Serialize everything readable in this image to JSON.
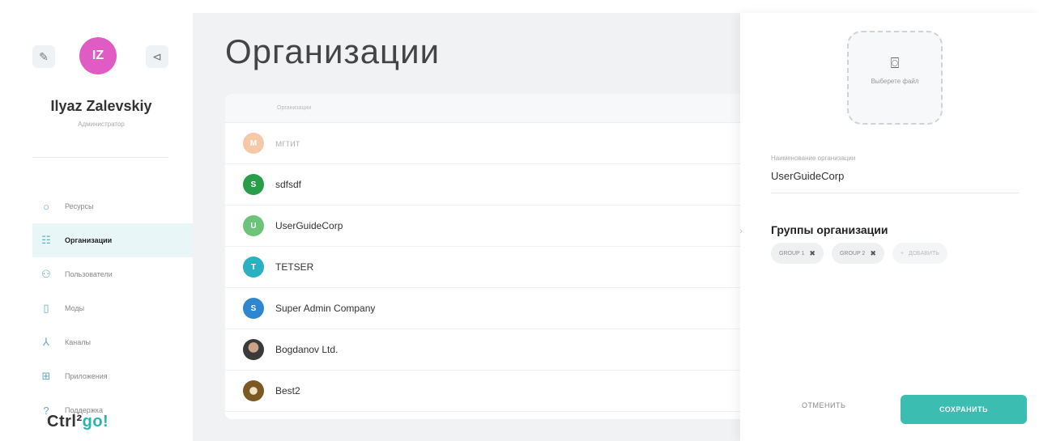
{
  "user": {
    "initials": "IZ",
    "name": "Ilyaz Zalevskiy",
    "role": "Администратор"
  },
  "sidebar": {
    "items": [
      {
        "label": "Ресурсы",
        "icon": "circle-icon"
      },
      {
        "label": "Организации",
        "icon": "org-chart-icon",
        "active": true
      },
      {
        "label": "Пользователи",
        "icon": "users-icon"
      },
      {
        "label": "Моды",
        "icon": "device-icon"
      },
      {
        "label": "Каналы",
        "icon": "channels-icon"
      },
      {
        "label": "Приложения",
        "icon": "apps-grid-icon"
      },
      {
        "label": "Поддержка",
        "icon": "help-icon"
      }
    ],
    "brand": {
      "part1": "Ctrl²",
      "part2": "go!"
    }
  },
  "main": {
    "title": "Организации",
    "table": {
      "header": "Организации",
      "rows": [
        {
          "initial": "M",
          "name": "мгтит",
          "color": "#f5c9a8",
          "faded": true
        },
        {
          "initial": "S",
          "name": "sdfsdf",
          "color": "#2a9d4a"
        },
        {
          "initial": "U",
          "name": "UserGuideCorp",
          "color": "#6cc47a"
        },
        {
          "initial": "T",
          "name": "TETSER",
          "color": "#2ab0c0"
        },
        {
          "initial": "S",
          "name": "Super Admin Company",
          "color": "#2f86d0"
        },
        {
          "initial": "",
          "name": "Bogdanov Ltd.",
          "color": "#4a4a4a"
        },
        {
          "initial": "",
          "name": "Best2",
          "color": "#8a6a2a"
        }
      ]
    }
  },
  "panel": {
    "upload_label": "Выберете файл",
    "org_name_label": "Наименование организации",
    "org_name_value": "UserGuideCorp",
    "groups_title": "Группы организации",
    "groups": [
      "GROUP 1",
      "GROUP 2"
    ],
    "add_label": "ДОБАВИТЬ",
    "cancel_label": "ОТМЕНИТЬ",
    "save_label": "СОХРАНИТЬ"
  },
  "colors": {
    "accent": "#3bbdb1",
    "avatar": "#e05cc4",
    "active_bg": "#e8f6f7"
  }
}
